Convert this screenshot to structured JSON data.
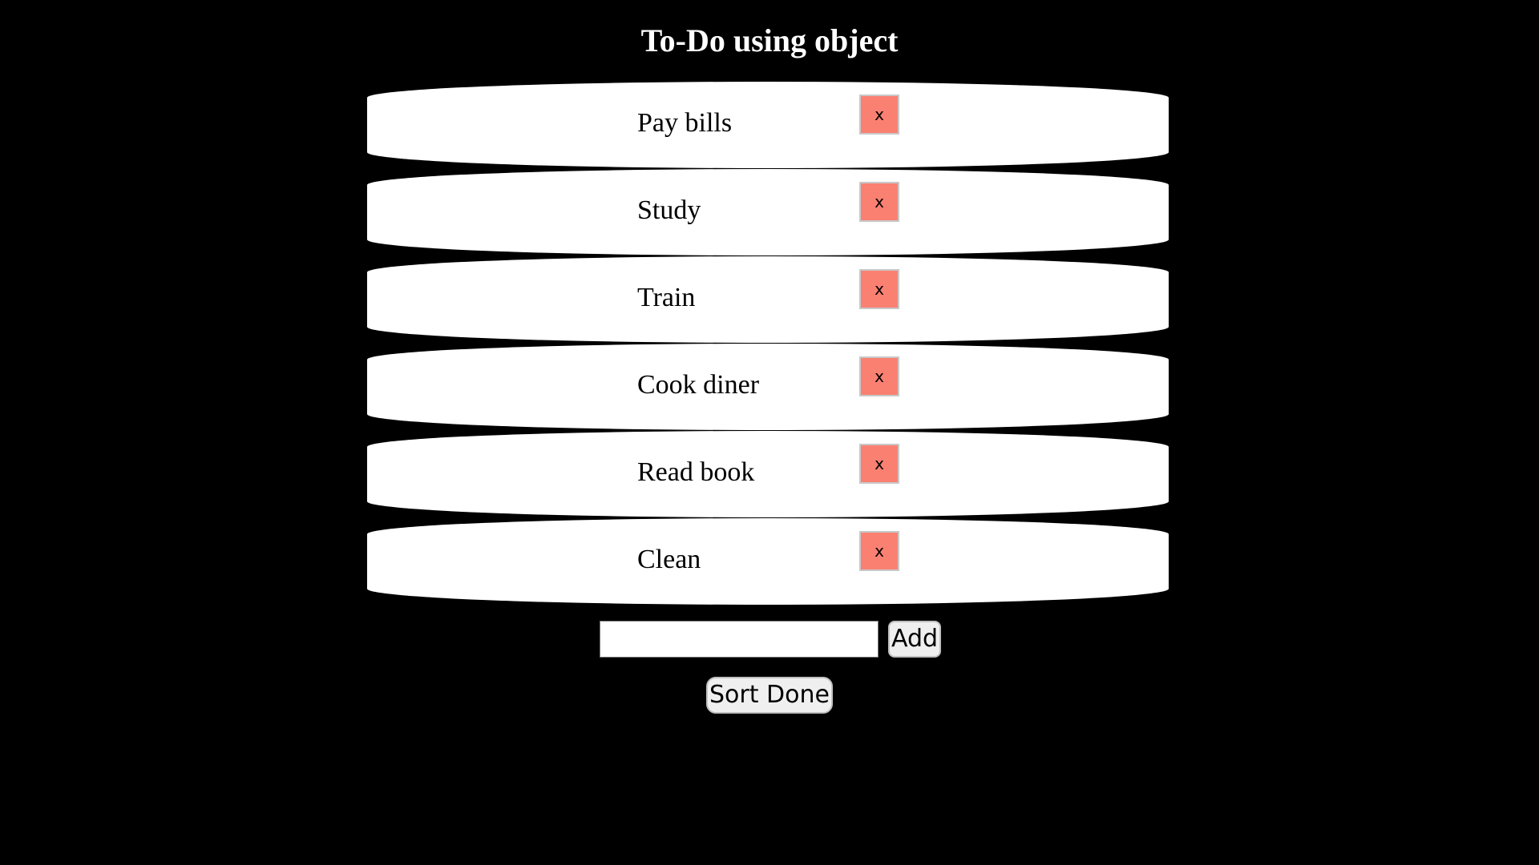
{
  "header": {
    "title": "To-Do using object"
  },
  "todos": [
    {
      "text": "Pay bills",
      "delete_label": "x"
    },
    {
      "text": "Study",
      "delete_label": "x"
    },
    {
      "text": "Train",
      "delete_label": "x"
    },
    {
      "text": "Cook diner",
      "delete_label": "x"
    },
    {
      "text": "Read book",
      "delete_label": "x"
    },
    {
      "text": "Clean",
      "delete_label": "x"
    }
  ],
  "form": {
    "input_value": "",
    "input_placeholder": "",
    "add_label": "Add"
  },
  "controls": {
    "sort_label": "Sort Done"
  },
  "colors": {
    "background": "#000000",
    "title": "#ffffff",
    "item_background": "#ffffff",
    "delete_button": "#fa8072"
  }
}
